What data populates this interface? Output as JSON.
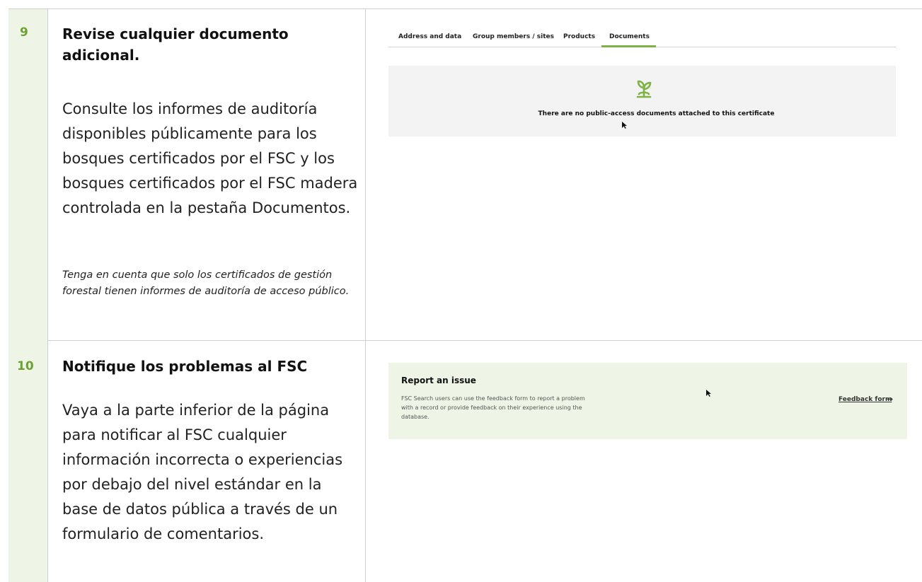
{
  "steps": [
    {
      "number": "9",
      "title": "Revise cualquier documento adicional.",
      "body": "Consulte los informes de auditoría disponibles públicamente para los bosques certificados por el FSC y los bosques certificados por el FSC madera controlada en la pestaña Documentos.",
      "note": "Tenga en cuenta que solo los certificados de gestión forestal tienen informes de auditoría de acceso público."
    },
    {
      "number": "10",
      "title": "Notifique los problemas al FSC",
      "body": "Vaya a la parte inferior de la página para notificar al FSC cualquier información incorrecta o experiencias por debajo del nivel estándar en la base de datos pública a través de un formulario de comentarios."
    }
  ],
  "certificate_tabs": {
    "items": [
      {
        "label": "Address and data",
        "active": false
      },
      {
        "label": "Group members / sites",
        "active": false
      },
      {
        "label": "Products",
        "active": false
      },
      {
        "label": "Documents",
        "active": true
      }
    ],
    "accent": "#7cb342"
  },
  "documents_panel": {
    "icon": "plant-sprout-icon",
    "message": "There are no public-access documents attached to this certificate"
  },
  "report_issue": {
    "title": "Report an issue",
    "description": "FSC Search users can use the feedback form to report a problem with a record or provide feedback on their experience using the database.",
    "link_label": "Feedback form",
    "link_arrow": "→"
  },
  "colors": {
    "step_number": "#6ba232",
    "number_column": "#eef5e6",
    "report_panel": "#eef5e6",
    "docs_panel": "#f3f3f3"
  }
}
